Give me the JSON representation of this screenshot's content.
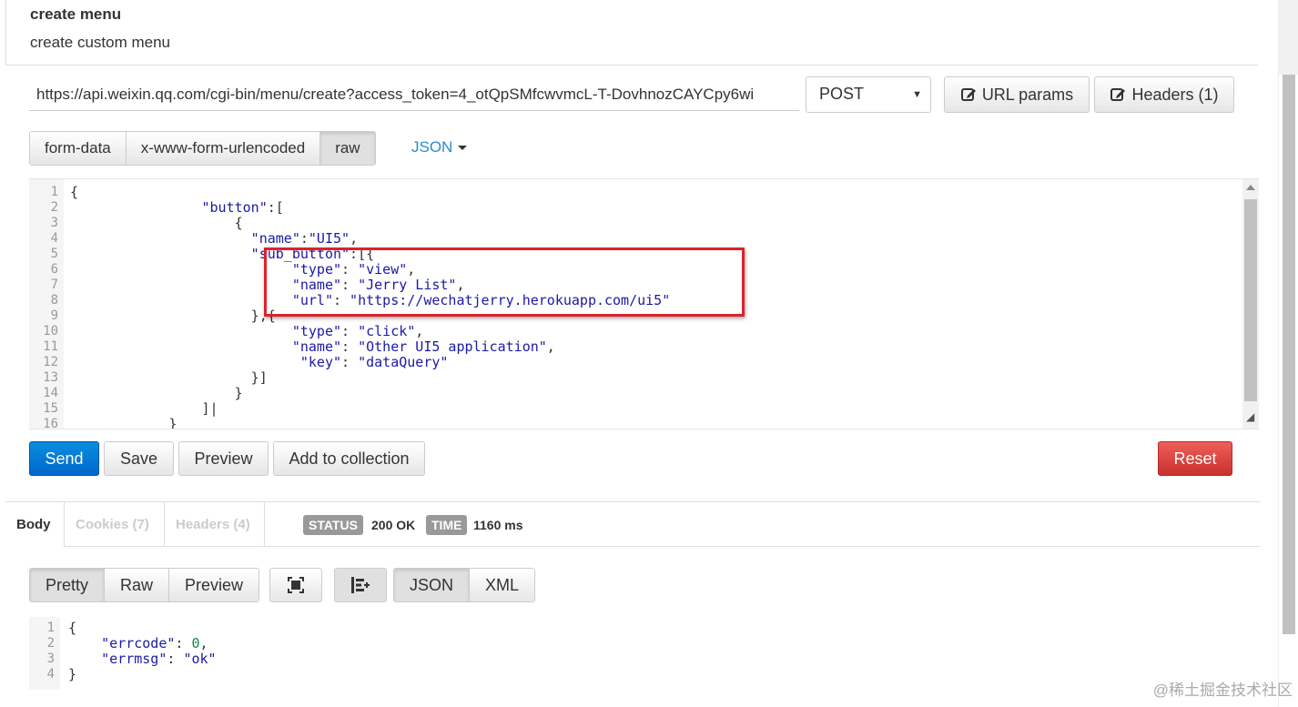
{
  "header": {
    "title": "create menu",
    "subtitle": "create custom menu"
  },
  "request": {
    "url": "https://api.weixin.qq.com/cgi-bin/menu/create?access_token=4_otQpSMfcwvmcL-T-DovhnozCAYCpy6wi",
    "method": "POST",
    "url_params_label": "URL params",
    "headers_label": "Headers (1)"
  },
  "body_tabs": [
    "form-data",
    "x-www-form-urlencoded",
    "raw"
  ],
  "body_tab_active": "raw",
  "body_format": "JSON",
  "editor": {
    "line_numbers": [
      "1",
      "2",
      "3",
      "4",
      "5",
      "6",
      "7",
      "8",
      "9",
      "10",
      "11",
      "12",
      "13",
      "14",
      "15",
      "16"
    ],
    "lines": [
      [
        {
          "t": "{",
          "c": ""
        }
      ],
      [
        {
          "t": "                \"button\"",
          "c": "s"
        },
        {
          "t": ":[",
          "c": ""
        }
      ],
      [
        {
          "t": "                    {",
          "c": ""
        }
      ],
      [
        {
          "t": "                      \"name\"",
          "c": "s"
        },
        {
          "t": ":",
          "c": ""
        },
        {
          "t": "\"UI5\"",
          "c": "s"
        },
        {
          "t": ",",
          "c": ""
        }
      ],
      [
        {
          "t": "                      \"sub_button\"",
          "c": "s"
        },
        {
          "t": ":[{",
          "c": ""
        }
      ],
      [
        {
          "t": "                           \"type\"",
          "c": "s"
        },
        {
          "t": ": ",
          "c": ""
        },
        {
          "t": "\"view\"",
          "c": "s"
        },
        {
          "t": ",",
          "c": ""
        }
      ],
      [
        {
          "t": "                           \"name\"",
          "c": "s"
        },
        {
          "t": ": ",
          "c": ""
        },
        {
          "t": "\"Jerry List\"",
          "c": "s"
        },
        {
          "t": ",",
          "c": ""
        }
      ],
      [
        {
          "t": "                           \"url\"",
          "c": "s"
        },
        {
          "t": ": ",
          "c": ""
        },
        {
          "t": "\"https://wechatjerry.herokuapp.com/ui5\"",
          "c": "s"
        }
      ],
      [
        {
          "t": "                      },{",
          "c": ""
        }
      ],
      [
        {
          "t": "                           \"type\"",
          "c": "s"
        },
        {
          "t": ": ",
          "c": ""
        },
        {
          "t": "\"click\"",
          "c": "s"
        },
        {
          "t": ",",
          "c": ""
        }
      ],
      [
        {
          "t": "                           \"name\"",
          "c": "s"
        },
        {
          "t": ": ",
          "c": ""
        },
        {
          "t": "\"Other UI5 application\"",
          "c": "s"
        },
        {
          "t": ",",
          "c": ""
        }
      ],
      [
        {
          "t": "                            \"key\"",
          "c": "s"
        },
        {
          "t": ": ",
          "c": ""
        },
        {
          "t": "\"dataQuery\"",
          "c": "s"
        }
      ],
      [
        {
          "t": "                      }]",
          "c": ""
        }
      ],
      [
        {
          "t": "                    }",
          "c": ""
        }
      ],
      [
        {
          "t": "                ]|",
          "c": ""
        }
      ],
      [
        {
          "t": "            }",
          "c": ""
        }
      ]
    ]
  },
  "actions": {
    "send": "Send",
    "save": "Save",
    "preview": "Preview",
    "add_to_collection": "Add to collection",
    "reset": "Reset"
  },
  "response": {
    "tabs": [
      "Body",
      "Cookies (7)",
      "Headers (4)"
    ],
    "status_label": "STATUS",
    "status_value": "200 OK",
    "time_label": "TIME",
    "time_value": "1160 ms",
    "view_tabs": [
      "Pretty",
      "Raw",
      "Preview"
    ],
    "format_tabs": [
      "JSON",
      "XML"
    ],
    "line_numbers": [
      "1",
      "2",
      "3",
      "4"
    ],
    "lines": [
      [
        {
          "t": "{",
          "c": ""
        }
      ],
      [
        {
          "t": "    \"errcode\"",
          "c": "s"
        },
        {
          "t": ": ",
          "c": ""
        },
        {
          "t": "0",
          "c": "n"
        },
        {
          "t": ",",
          "c": ""
        }
      ],
      [
        {
          "t": "    \"errmsg\"",
          "c": "s"
        },
        {
          "t": ": ",
          "c": ""
        },
        {
          "t": "\"ok\"",
          "c": "s"
        }
      ],
      [
        {
          "t": "}",
          "c": ""
        }
      ]
    ]
  },
  "watermark": "@稀土掘金技术社区",
  "colors": {
    "send": "#0074d9",
    "reset": "#d9534f",
    "json_key": "#1a1aa6",
    "highlight_box": "#e0202a"
  }
}
